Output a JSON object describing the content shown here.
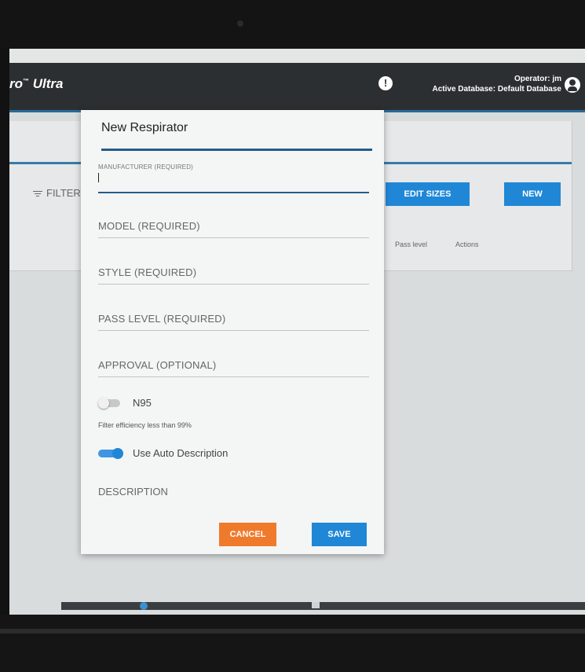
{
  "app": {
    "title": "ro",
    "title_tm": "™",
    "title_suffix": " Ultra",
    "operator_line": "Operator: jm",
    "database_line": "Active Database: Default Database"
  },
  "background": {
    "filter_label": "FILTER",
    "edit_sizes_label": "EDIT SIZES",
    "new_label": "NEW",
    "columns": [
      "Pass level",
      "Actions"
    ]
  },
  "dialog": {
    "title": "New Respirator",
    "fields": [
      {
        "label": "MANUFACTURER (REQUIRED)",
        "value": ""
      },
      {
        "label": "MODEL (REQUIRED)",
        "value": ""
      },
      {
        "label": "STYLE (REQUIRED)",
        "value": ""
      },
      {
        "label": "PASS LEVEL (REQUIRED)",
        "value": ""
      },
      {
        "label": "APPROVAL (OPTIONAL)",
        "value": ""
      }
    ],
    "n95": {
      "label": "N95",
      "checked": false
    },
    "filter_hint": "Filter efficiency less than 99%",
    "auto_desc": {
      "label": "Use Auto Description",
      "checked": true
    },
    "description_label": "DESCRIPTION",
    "cancel_label": "CANCEL",
    "save_label": "SAVE"
  },
  "colors": {
    "primary": "#1f87d6",
    "accent": "#f07a2b",
    "appbar": "#2c2f31"
  }
}
